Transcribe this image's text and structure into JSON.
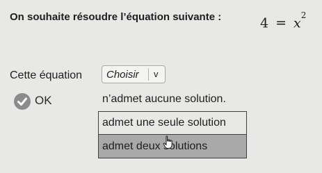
{
  "question": {
    "text": "On souhaite résoudre l’équation suivante :",
    "equation": {
      "lhs": "4",
      "operator": "=",
      "variable": "x",
      "exponent": "2"
    }
  },
  "statement": {
    "prefix": "Cette équation",
    "select": {
      "placeholder": "Choisir",
      "chevron": "v",
      "options": [
        "n’admet aucune solution.",
        "admet une seule solution",
        "admet deux solutions"
      ]
    }
  },
  "ok_button": {
    "label": "OK",
    "icon": "check-circle-icon",
    "color": "#8b8b8b"
  },
  "icons": {
    "cursor": "hand-pointer-icon"
  }
}
